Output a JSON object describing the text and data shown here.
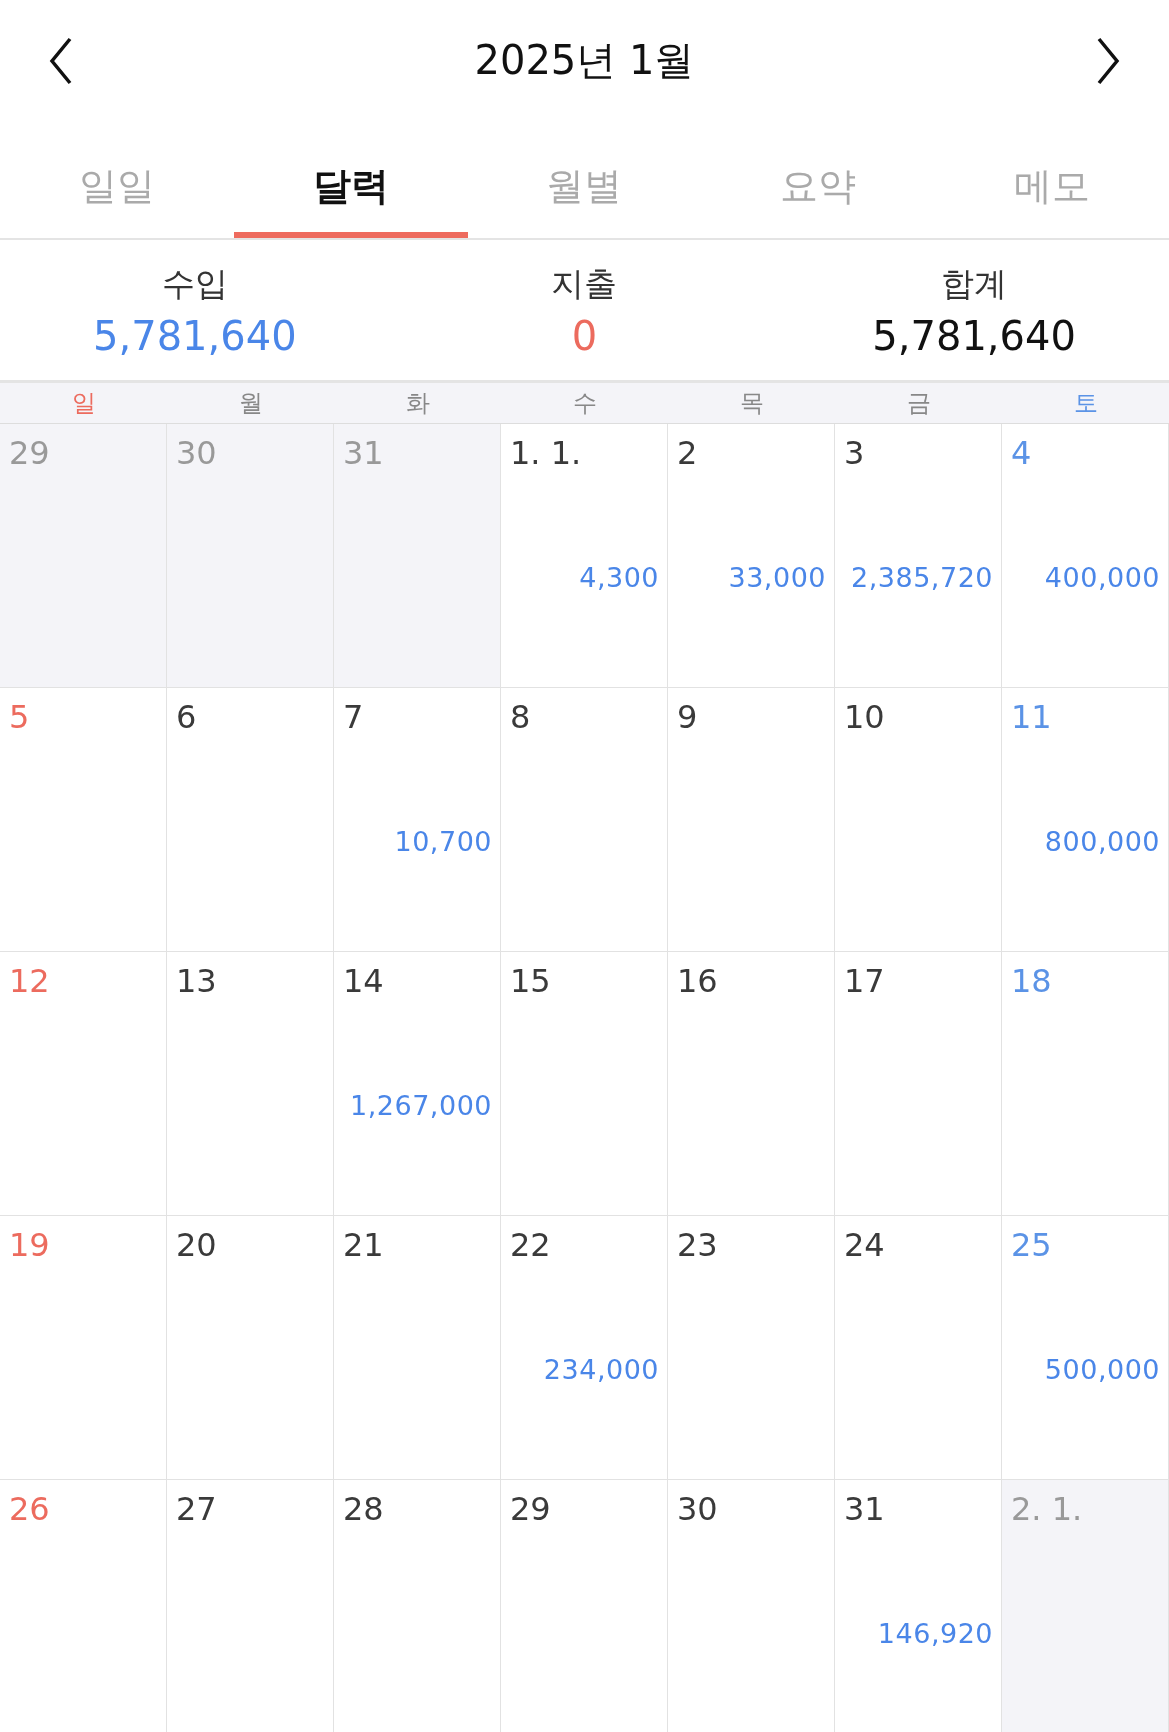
{
  "header": {
    "title": "2025년 1월"
  },
  "tabs": [
    {
      "label": "일일",
      "selected": false
    },
    {
      "label": "달력",
      "selected": true
    },
    {
      "label": "월별",
      "selected": false
    },
    {
      "label": "요약",
      "selected": false
    },
    {
      "label": "메모",
      "selected": false
    }
  ],
  "summary": [
    {
      "kind": "income",
      "label": "수입",
      "value": "5,781,640"
    },
    {
      "kind": "expense",
      "label": "지출",
      "value": "0"
    },
    {
      "kind": "total",
      "label": "합계",
      "value": "5,781,640"
    }
  ],
  "weekdays": [
    {
      "label": "일",
      "kind": "sun"
    },
    {
      "label": "월",
      "kind": "weekday"
    },
    {
      "label": "화",
      "kind": "weekday"
    },
    {
      "label": "수",
      "kind": "weekday"
    },
    {
      "label": "목",
      "kind": "weekday"
    },
    {
      "label": "금",
      "kind": "weekday"
    },
    {
      "label": "토",
      "kind": "sat"
    }
  ],
  "weeks": [
    [
      {
        "day": "29",
        "kind": "sun",
        "other_month": true
      },
      {
        "day": "30",
        "kind": "weekday",
        "other_month": true
      },
      {
        "day": "31",
        "kind": "weekday",
        "other_month": true
      },
      {
        "day": "1. 1.",
        "kind": "weekday",
        "other_month": false,
        "amount": "4,300"
      },
      {
        "day": "2",
        "kind": "weekday",
        "other_month": false,
        "amount": "33,000"
      },
      {
        "day": "3",
        "kind": "weekday",
        "other_month": false,
        "amount": "2,385,720"
      },
      {
        "day": "4",
        "kind": "sat",
        "other_month": false,
        "amount": "400,000"
      }
    ],
    [
      {
        "day": "5",
        "kind": "sun",
        "other_month": false
      },
      {
        "day": "6",
        "kind": "weekday",
        "other_month": false
      },
      {
        "day": "7",
        "kind": "weekday",
        "other_month": false,
        "amount": "10,700"
      },
      {
        "day": "8",
        "kind": "weekday",
        "other_month": false
      },
      {
        "day": "9",
        "kind": "weekday",
        "other_month": false
      },
      {
        "day": "10",
        "kind": "weekday",
        "other_month": false
      },
      {
        "day": "11",
        "kind": "sat",
        "other_month": false,
        "amount": "800,000"
      }
    ],
    [
      {
        "day": "12",
        "kind": "sun",
        "other_month": false
      },
      {
        "day": "13",
        "kind": "weekday",
        "other_month": false
      },
      {
        "day": "14",
        "kind": "weekday",
        "other_month": false,
        "amount": "1,267,000"
      },
      {
        "day": "15",
        "kind": "weekday",
        "other_month": false
      },
      {
        "day": "16",
        "kind": "weekday",
        "other_month": false
      },
      {
        "day": "17",
        "kind": "weekday",
        "other_month": false
      },
      {
        "day": "18",
        "kind": "sat",
        "other_month": false
      }
    ],
    [
      {
        "day": "19",
        "kind": "sun",
        "other_month": false
      },
      {
        "day": "20",
        "kind": "weekday",
        "other_month": false
      },
      {
        "day": "21",
        "kind": "weekday",
        "other_month": false
      },
      {
        "day": "22",
        "kind": "weekday",
        "other_month": false,
        "amount": "234,000"
      },
      {
        "day": "23",
        "kind": "weekday",
        "other_month": false
      },
      {
        "day": "24",
        "kind": "weekday",
        "other_month": false
      },
      {
        "day": "25",
        "kind": "sat",
        "other_month": false,
        "amount": "500,000"
      }
    ],
    [
      {
        "day": "26",
        "kind": "sun",
        "other_month": false
      },
      {
        "day": "27",
        "kind": "weekday",
        "other_month": false
      },
      {
        "day": "28",
        "kind": "weekday",
        "other_month": false
      },
      {
        "day": "29",
        "kind": "weekday",
        "other_month": false
      },
      {
        "day": "30",
        "kind": "weekday",
        "other_month": false
      },
      {
        "day": "31",
        "kind": "weekday",
        "other_month": false,
        "amount": "146,920"
      },
      {
        "day": "2. 1.",
        "kind": "sat",
        "other_month": true
      }
    ]
  ]
}
